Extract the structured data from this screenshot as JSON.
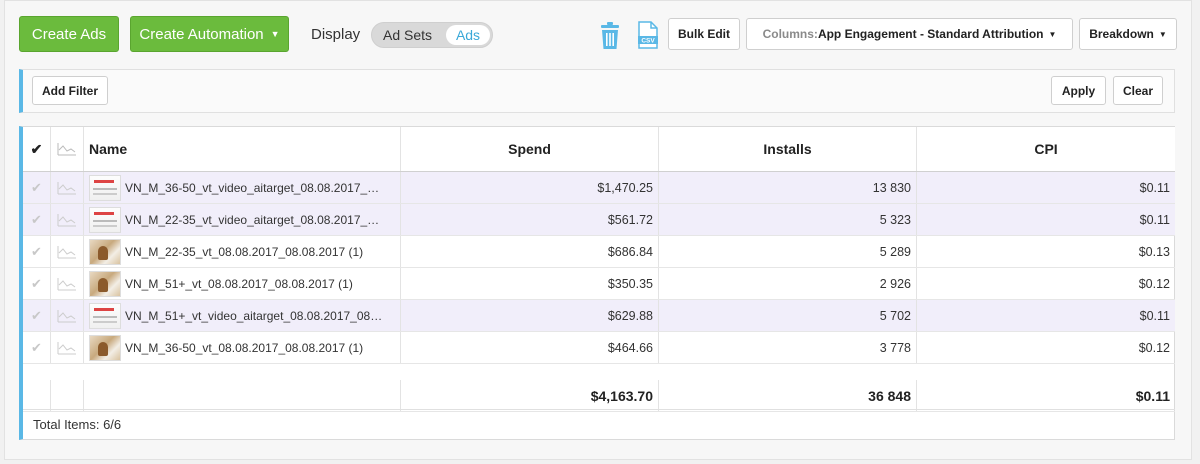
{
  "toolbar": {
    "create_ads": "Create Ads",
    "create_automation": "Create Automation",
    "display_label": "Display",
    "toggle_ad_sets": "Ad Sets",
    "toggle_ads": "Ads",
    "bulk_edit": "Bulk Edit",
    "columns_label": "Columns:",
    "columns_value": "App Engagement - Standard Attribution",
    "breakdown": "Breakdown",
    "icons": [
      "trash-icon",
      "csv-icon"
    ]
  },
  "filter": {
    "add_filter": "Add Filter",
    "apply": "Apply",
    "clear": "Clear"
  },
  "table": {
    "headers": {
      "name": "Name",
      "spend": "Spend",
      "installs": "Installs",
      "cpi": "CPI"
    },
    "rows": [
      {
        "name": "VN_M_36-50_vt_video_aitarget_08.08.2017_…",
        "spend": "$1,470.25",
        "installs": "13 830",
        "cpi": "$0.11",
        "thumb": "video",
        "highlight": true
      },
      {
        "name": "VN_M_22-35_vt_video_aitarget_08.08.2017_…",
        "spend": "$561.72",
        "installs": "5 323",
        "cpi": "$0.11",
        "thumb": "video",
        "highlight": true
      },
      {
        "name": "VN_M_22-35_vt_08.08.2017_08.08.2017 (1)",
        "spend": "$686.84",
        "installs": "5 289",
        "cpi": "$0.13",
        "thumb": "photo",
        "highlight": false
      },
      {
        "name": "VN_M_51+_vt_08.08.2017_08.08.2017 (1)",
        "spend": "$350.35",
        "installs": "2 926",
        "cpi": "$0.12",
        "thumb": "photo",
        "highlight": false
      },
      {
        "name": "VN_M_51+_vt_video_aitarget_08.08.2017_08…",
        "spend": "$629.88",
        "installs": "5 702",
        "cpi": "$0.11",
        "thumb": "video",
        "highlight": true
      },
      {
        "name": "VN_M_36-50_vt_08.08.2017_08.08.2017 (1)",
        "spend": "$464.66",
        "installs": "3 778",
        "cpi": "$0.12",
        "thumb": "photo",
        "highlight": false
      }
    ],
    "totals": {
      "spend": "$4,163.70",
      "installs": "36 848",
      "cpi": "$0.11"
    },
    "footer": "Total Items: 6/6"
  },
  "colors": {
    "green": "#6bbb3d",
    "accent_blue": "#5ab8e6",
    "highlight_row": "#f1eefa",
    "icon_blue": "#39a8d8"
  }
}
